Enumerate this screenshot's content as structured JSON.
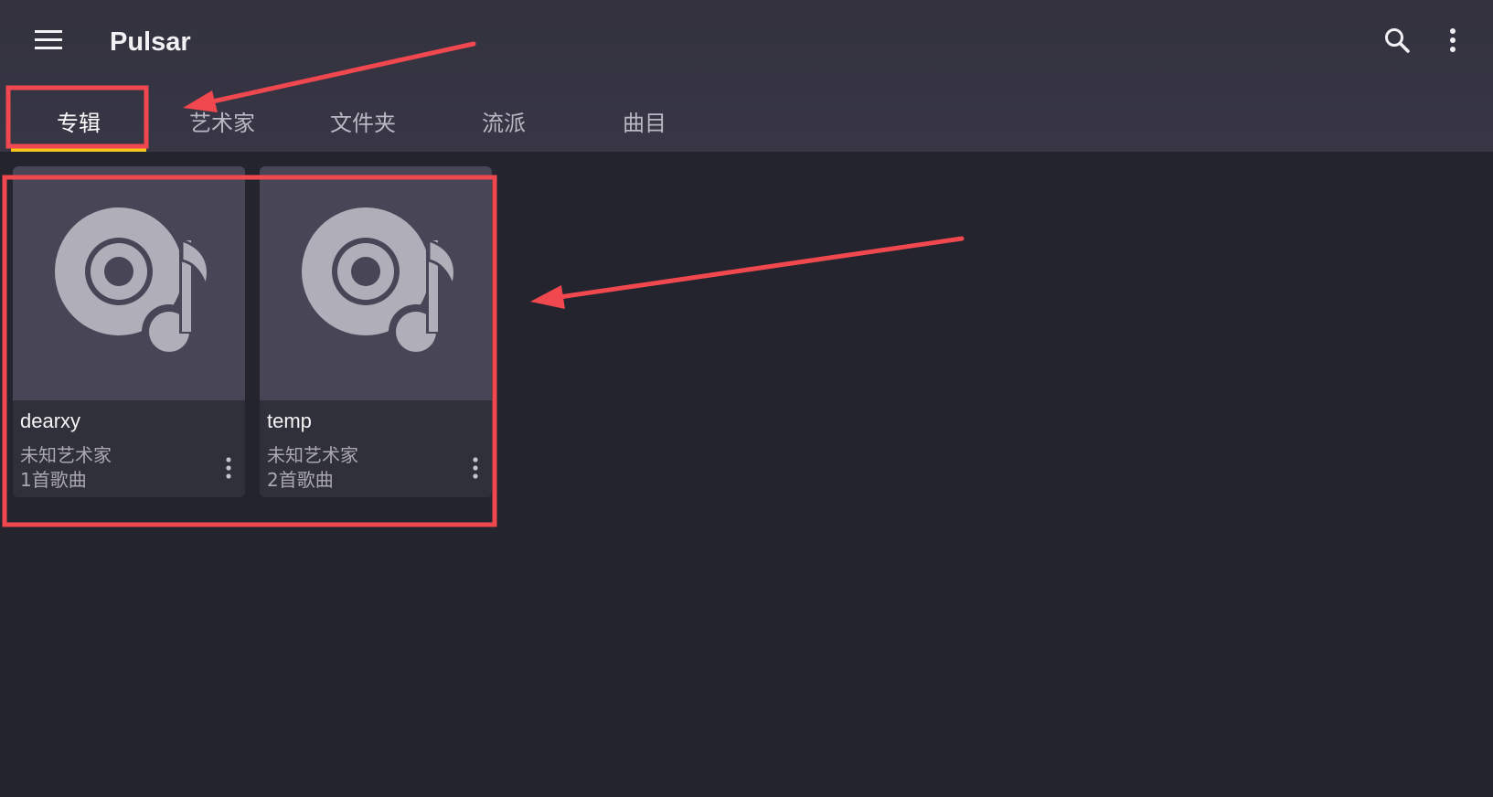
{
  "app": {
    "title": "Pulsar",
    "icons": {
      "menu": "hamburger-menu-icon",
      "search": "search-icon",
      "more": "more-vertical-icon"
    }
  },
  "tabs": [
    {
      "label": "专辑",
      "active": true
    },
    {
      "label": "艺术家",
      "active": false
    },
    {
      "label": "文件夹",
      "active": false
    },
    {
      "label": "流派",
      "active": false
    },
    {
      "label": "曲目",
      "active": false
    }
  ],
  "albums": [
    {
      "title": "dearxy",
      "artist": "未知艺术家",
      "count": "1首歌曲",
      "cover_icon": "album-placeholder-icon"
    },
    {
      "title": "temp",
      "artist": "未知艺术家",
      "count": "2首歌曲",
      "cover_icon": "album-placeholder-icon"
    }
  ],
  "colors": {
    "background": "#23242d",
    "toolbar": "#383645",
    "accent": "#f5c518",
    "annotation": "#f0484e"
  }
}
